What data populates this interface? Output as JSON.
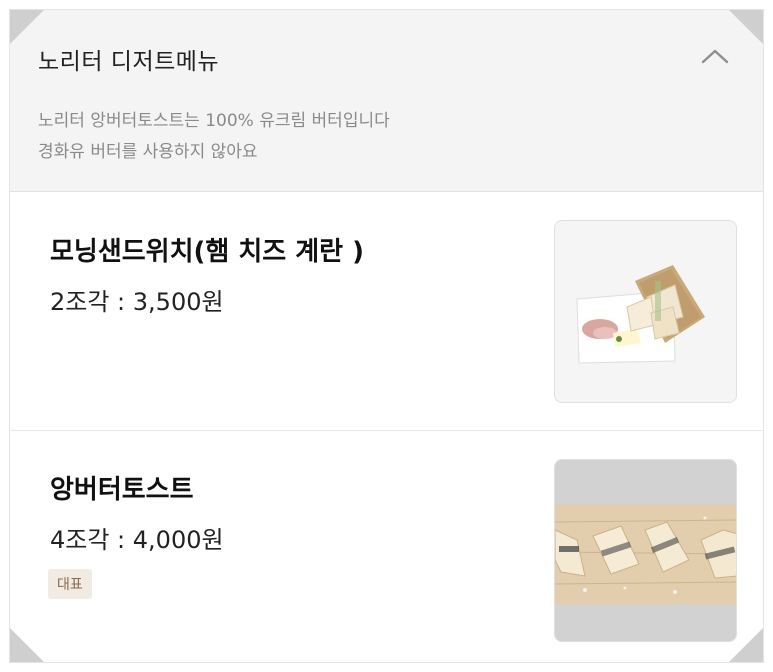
{
  "header": {
    "title": "노리터 디저트메뉴",
    "description_lines": [
      "노리터 앙버터토스트는 100% 유크림 버터입니다",
      "경화유 버터를 사용하지 않아요"
    ],
    "collapse_icon": "chevron-up-icon"
  },
  "menu_items": [
    {
      "name": "모닝샌드위치(햄 치즈 계란 )",
      "price": "2조각 : 3,500원",
      "image_alt": "sandwich-plate-image"
    },
    {
      "name": "앙버터토스트",
      "price": "4조각 : 4,000원",
      "badge": "대표",
      "image_alt": "ang-butter-toast-board-image"
    }
  ]
}
